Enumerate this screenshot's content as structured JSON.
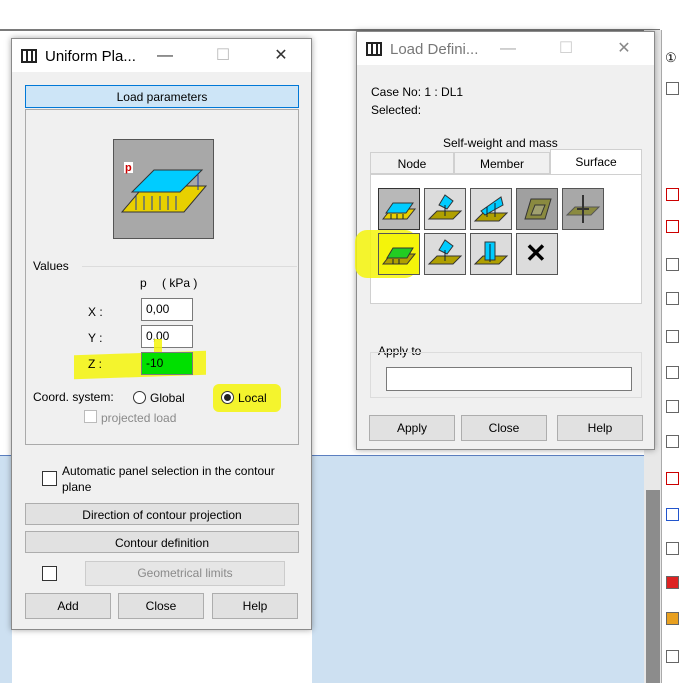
{
  "left_dialog": {
    "title": "Uniform Pla...",
    "minimize": "—",
    "maximize": "☐",
    "close": "✕",
    "load_parameters_btn": "Load parameters",
    "values_label": "Values",
    "p_header": "p",
    "unit": "( kPa )",
    "x_label": "X :",
    "x_value": "0,00",
    "y_label": "Y :",
    "y_value": "0,00",
    "z_label": "Z :",
    "z_value": "-10",
    "coord_label": "Coord. system:",
    "global_label": "Global",
    "local_label": "Local",
    "projected_label": "projected load",
    "auto_panel_label": "Automatic panel selection in the contour plane",
    "direction_btn": "Direction of contour projection",
    "contour_btn": "Contour definition",
    "geom_btn": "Geometrical limits",
    "add_btn": "Add",
    "close_btn": "Close",
    "help_btn": "Help",
    "load_icon_label": "p"
  },
  "right_dialog": {
    "title": "Load Defini...",
    "minimize": "—",
    "maximize": "☐",
    "close": "✕",
    "case_label": "Case No:  1 : DL1",
    "selected_label": "Selected:",
    "selfweight_btn": "Self-weight and mass",
    "tabs": [
      {
        "label": "Node"
      },
      {
        "label": "Member"
      },
      {
        "label": "Surface"
      }
    ],
    "apply_to_label": "Apply to",
    "apply_to_value": "",
    "apply_btn": "Apply",
    "close_btn": "Close",
    "help_btn": "Help",
    "delete_glyph": "✕"
  },
  "right_strip": {
    "top_glyph": "①"
  },
  "colors": {
    "highlight": "#f4f40a",
    "z_field": "#00e000",
    "plate": "#00ccff"
  }
}
